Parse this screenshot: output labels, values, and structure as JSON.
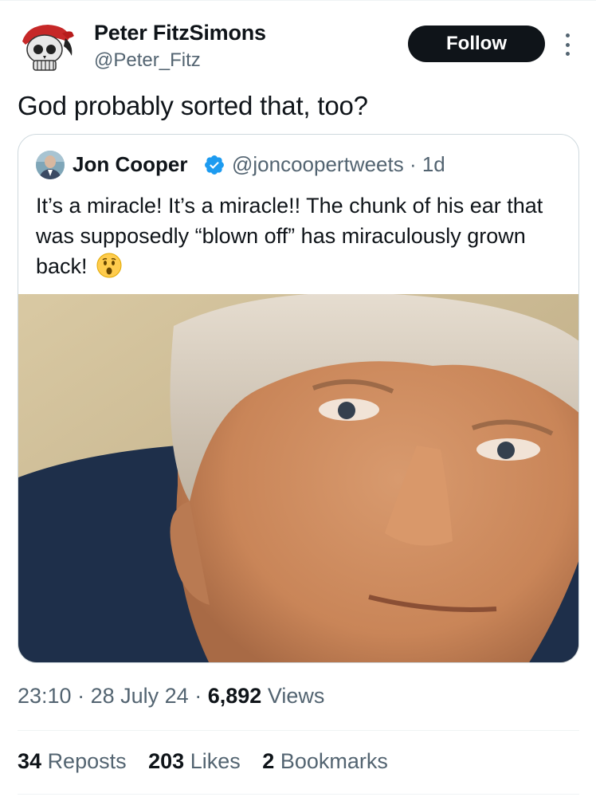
{
  "tweet": {
    "author": {
      "name": "Peter FitzSimons",
      "handle": "@Peter_Fitz"
    },
    "follow_label": "Follow",
    "text": "God probably sorted that, too?"
  },
  "quote": {
    "author": {
      "name": "Jon Cooper",
      "handle": "@joncoopertweets",
      "age": "· 1d"
    },
    "text": "It’s a miracle! It’s a miracle!! The chunk of his ear that was supposedly “blown off” has miraculously grown back!",
    "emoji": "astonished-face-icon"
  },
  "meta": {
    "time": "23:10",
    "date": "28 July 24",
    "views_count": "6,892",
    "views_label": "Views",
    "separator": "·"
  },
  "stats": {
    "reposts_count": "34",
    "reposts_label": "Reposts",
    "likes_count": "203",
    "likes_label": "Likes",
    "bookmarks_count": "2",
    "bookmarks_label": "Bookmarks"
  },
  "colors": {
    "text": "#0f1419",
    "secondary": "#536471",
    "verified": "#1d9bf0",
    "border": "#cfd9de",
    "divider": "#eff3f4"
  }
}
